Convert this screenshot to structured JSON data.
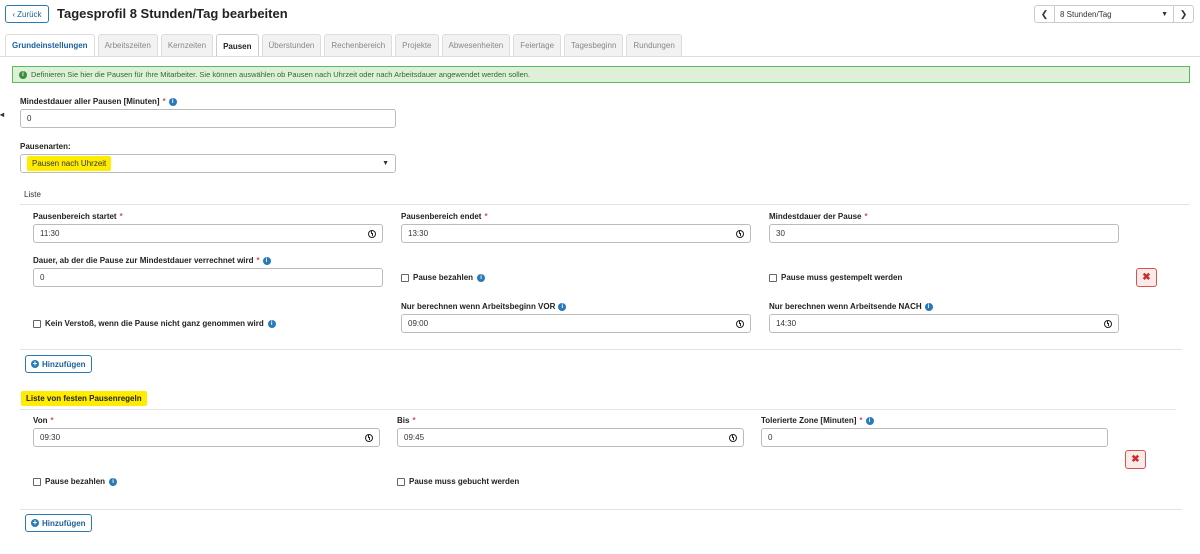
{
  "header": {
    "back_label": "Zurück",
    "title": "Tagesprofil 8 Stunden/Tag bearbeiten",
    "profile_select": "8 Stunden/Tag",
    "prev_icon": "chevron-left-icon",
    "next_icon": "chevron-right-icon"
  },
  "tabs": [
    {
      "label": "Grundeinstellungen"
    },
    {
      "label": "Arbeitszeiten"
    },
    {
      "label": "Kernzeiten"
    },
    {
      "label": "Pausen"
    },
    {
      "label": "Überstunden"
    },
    {
      "label": "Rechenbereich"
    },
    {
      "label": "Projekte"
    },
    {
      "label": "Abwesenheiten"
    },
    {
      "label": "Feiertage"
    },
    {
      "label": "Tagesbeginn"
    },
    {
      "label": "Rundungen"
    }
  ],
  "active_tab": "Pausen",
  "info_text": "Definieren Sie hier die Pausen für Ihre Mitarbeiter. Sie können auswählen ob Pausen nach Uhrzeit oder nach Arbeitsdauer angewendet werden sollen.",
  "form": {
    "min_all_label": "Mindestdauer aller Pausen [Minuten]",
    "min_all_value": "0",
    "types_label": "Pausenarten:",
    "types_value": "Pausen nach Uhrzeit",
    "list_title": "Liste"
  },
  "pause_entry": {
    "start_label": "Pausenbereich startet",
    "start_value": "11:30",
    "end_label": "Pausenbereich endet",
    "end_value": "13:30",
    "min_label": "Mindestdauer der Pause",
    "min_value": "30",
    "duration_label": "Dauer, ab der die Pause zur Mindestdauer verrechnet wird",
    "duration_value": "0",
    "pay_label": "Pause bezahlen",
    "stamp_label": "Pause muss gestempelt werden",
    "no_violation_label": "Kein Verstoß, wenn die Pause nicht ganz genommen wird",
    "before_label": "Nur berechnen wenn Arbeitsbeginn VOR",
    "before_value": "09:00",
    "after_label": "Nur berechnen wenn Arbeitsende NACH",
    "after_value": "14:30"
  },
  "add_label": "Hinzufügen",
  "fixed": {
    "title": "Liste von festen Pausenregeln",
    "from_label": "Von",
    "from_value": "09:30",
    "to_label": "Bis",
    "to_value": "09:45",
    "tolerance_label": "Tolerierte Zone [Minuten]",
    "tolerance_value": "0",
    "pay_label": "Pause bezahlen",
    "book_label": "Pause muss gebucht werden"
  },
  "required_mark": "*",
  "colors": {
    "primary": "#2a7ab8",
    "highlight": "#ffec00",
    "danger": "#d9534f",
    "info_bg": "#dff0d8"
  }
}
